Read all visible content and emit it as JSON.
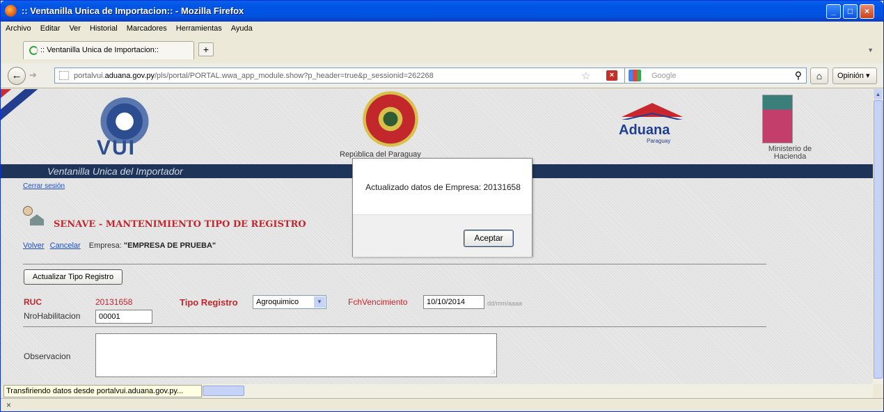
{
  "window": {
    "title": ":: Ventanilla Unica de Importacion:: - Mozilla Firefox"
  },
  "menu": [
    "Archivo",
    "Editar",
    "Ver",
    "Historial",
    "Marcadores",
    "Herramientas",
    "Ayuda"
  ],
  "tab": {
    "title": ":: Ventanilla Unica de Importacion::",
    "new_tab": "+"
  },
  "address": {
    "prefix": "portalvui.",
    "domain": "aduana.gov.py",
    "path": "/pls/portal/PORTAL.wwa_app_module.show?p_header=true&p_sessionid=262268"
  },
  "search": {
    "placeholder": "Google"
  },
  "toolbar": {
    "opinion": "Opinión"
  },
  "header": {
    "vui_label": "VUI",
    "republic": "República del Paraguay",
    "aduana": "Aduana",
    "aduana_sub": "Paraguay",
    "ministerio": "Ministerio de Hacienda",
    "band": "Ventanilla Unica del Importador"
  },
  "page": {
    "logout": "Cerrar sesión",
    "title": "SENAVE - MANTENIMIENTO TIPO DE REGISTRO",
    "back": "Volver",
    "cancel": "Cancelar",
    "company_label": "Empresa:",
    "company_value": "\"EMPRESA DE PRUEBA\"",
    "update_button": "Actualizar Tipo Registro"
  },
  "form": {
    "ruc_label": "RUC",
    "ruc_value": "20131658",
    "tipo_label": "Tipo Registro",
    "tipo_value": "Agroquimico",
    "fch_label": "FchVencimiento",
    "fch_value": "10/10/2014",
    "fch_format": "dd/mm/aaaa",
    "nro_label": "NroHabilitacion",
    "nro_value": "00001",
    "obs_label": "Observacion"
  },
  "dialog": {
    "message": "Actualizado datos de Empresa: 20131658",
    "ok": "Aceptar"
  },
  "status": {
    "text": "Transfiriendo datos desde portalvui.aduana.gov.py..."
  },
  "colors": {
    "accent_red": "#C0282D",
    "band_navy": "#1E3459",
    "link_blue": "#1F4FBD"
  }
}
